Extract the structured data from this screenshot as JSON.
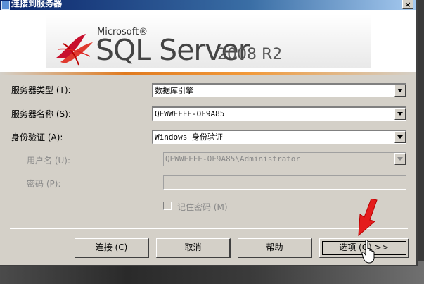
{
  "dialog": {
    "title": "连接到服务器",
    "close_label": "×"
  },
  "banner": {
    "microsoft": "Microsoft®",
    "product": "SQL Server",
    "version": "2008 R2"
  },
  "form": {
    "server_type": {
      "label": "服务器类型 (T):",
      "value": "数据库引擎"
    },
    "server_name": {
      "label": "服务器名称 (S):",
      "value": "QEWWEFFE-OF9A85"
    },
    "authentication": {
      "label": "身份验证 (A):",
      "value": "Windows 身份验证"
    },
    "username": {
      "label": "用户名 (U):",
      "value": "QEWWEFFE-OF9A85\\Administrator"
    },
    "password": {
      "label": "密码 (P):",
      "value": ""
    },
    "remember_password": {
      "label": "记住密码 (M)",
      "checked": false
    }
  },
  "buttons": {
    "connect": "连接 (C)",
    "cancel": "取消",
    "help": "帮助",
    "options": "选项 (O) >>"
  },
  "colors": {
    "dialog_bg": "#d4d0c8",
    "title_start": "#0a246a",
    "title_end": "#a6caf0",
    "accent_orange": "#e07a1f",
    "annotation_red": "#e41c1c"
  },
  "icons": [
    "sql-server-logo-icon",
    "dropdown-arrow-icon",
    "mouse-cursor-icon",
    "red-arrow-annotation"
  ]
}
